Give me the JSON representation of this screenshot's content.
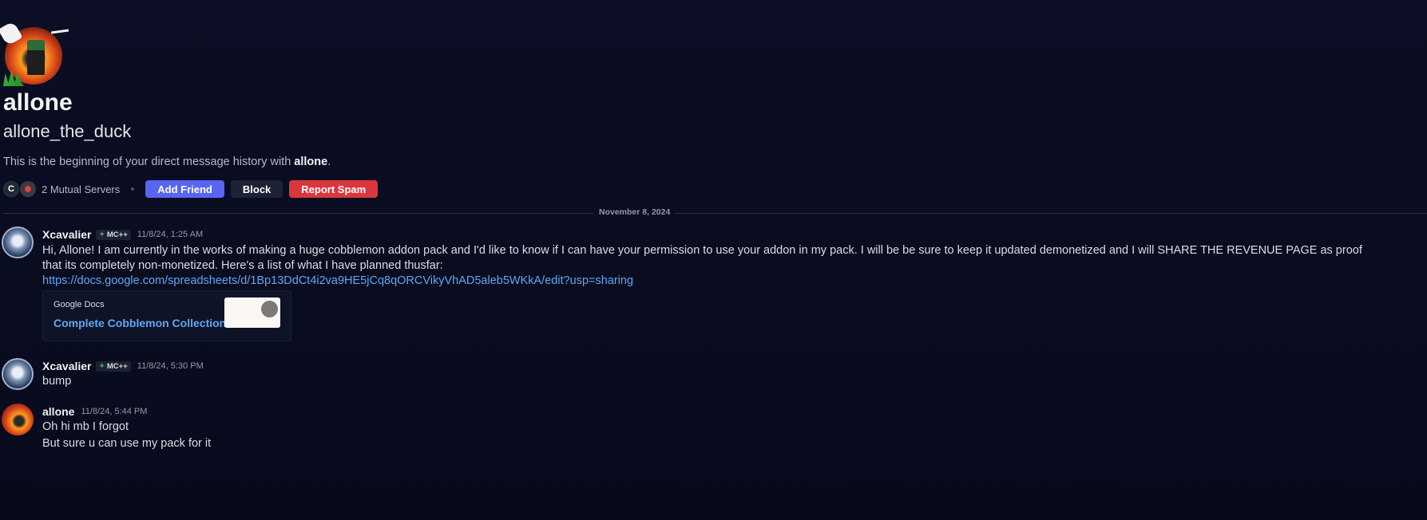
{
  "profile": {
    "display_name": "allone",
    "username": "allone_the_duck",
    "intro_prefix": "This is the beginning of your direct message history with ",
    "intro_name": "allone",
    "intro_suffix": ".",
    "mutual_servers": "2 Mutual Servers",
    "buttons": {
      "add_friend": "Add Friend",
      "block": "Block",
      "report_spam": "Report Spam"
    }
  },
  "divider": {
    "date": "November 8, 2024"
  },
  "messages": [
    {
      "author": "Xcavalier",
      "tag": "MC++",
      "timestamp": "11/8/24, 1:25 AM",
      "lines": [
        "Hi, Allone! I am currently in the works of making a huge cobblemon addon pack and I'd like to know if I can have your permission to use your addon in my pack. I will be be sure to keep it updated demonetized and I will SHARE THE REVENUE PAGE as proof",
        "that its completely non-monetized. Here's a list of what I have planned thusfar:"
      ],
      "link": "https://docs.google.com/spreadsheets/d/1Bp13DdCt4i2va9HE5jCq8qORCVikyVhAD5aleb5WKkA/edit?usp=sharing",
      "embed": {
        "provider": "Google Docs",
        "title": "Complete Cobblemon Collection"
      }
    },
    {
      "author": "Xcavalier",
      "tag": "MC++",
      "timestamp": "11/8/24, 5:30 PM",
      "lines": [
        "bump"
      ]
    },
    {
      "author": "allone",
      "timestamp": "11/8/24, 5:44 PM",
      "lines": [
        "Oh hi mb I forgot",
        "But sure u can use my pack for it"
      ]
    }
  ],
  "colors": {
    "blurple": "#5865f2",
    "danger": "#da373c",
    "link": "#5fa8f5",
    "background": "#0a0c20"
  }
}
